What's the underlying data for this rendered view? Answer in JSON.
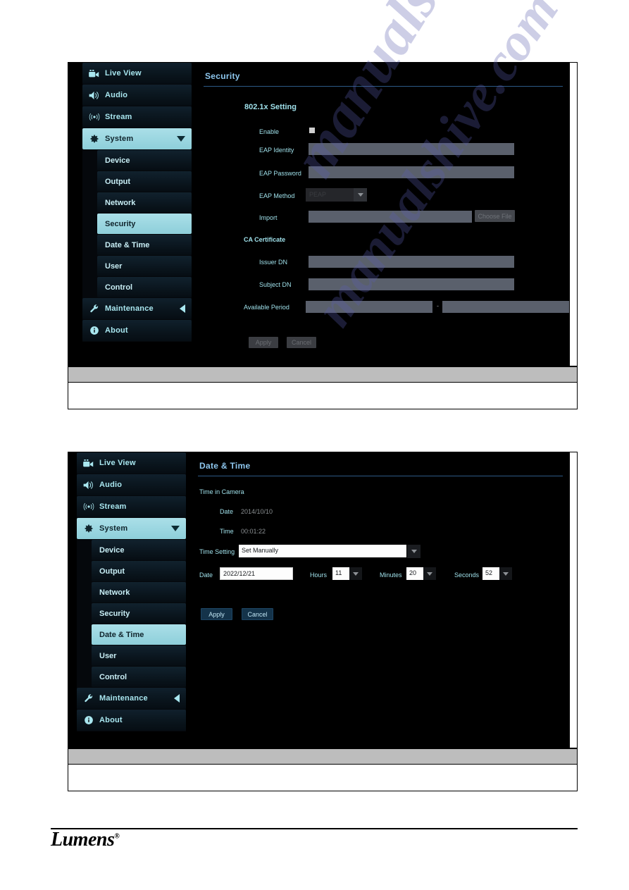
{
  "footer": {
    "brand": "Lumens",
    "registered_mark": "®"
  },
  "watermark": {
    "line1": "manualshive.com",
    "line2": "manualshive.com"
  },
  "figures": [
    {
      "id": "security-page",
      "pane_title": "Security",
      "sidebar": {
        "items": [
          {
            "label": "Live View",
            "icon": "video-camera-icon",
            "state": "normal",
            "arrow": "none"
          },
          {
            "label": "Audio",
            "icon": "speaker-icon",
            "state": "normal",
            "arrow": "none"
          },
          {
            "label": "Stream",
            "icon": "broadcast-icon",
            "state": "normal",
            "arrow": "none"
          },
          {
            "label": "System",
            "icon": "gear-icon",
            "state": "active",
            "arrow": "down"
          }
        ],
        "sub_items": [
          {
            "label": "Device",
            "state": "normal"
          },
          {
            "label": "Output",
            "state": "normal"
          },
          {
            "label": "Network",
            "state": "normal"
          },
          {
            "label": "Security",
            "state": "active"
          },
          {
            "label": "Date & Time",
            "state": "normal"
          },
          {
            "label": "User",
            "state": "normal"
          },
          {
            "label": "Control",
            "state": "normal"
          }
        ],
        "bottom_items": [
          {
            "label": "Maintenance",
            "icon": "wrench-icon",
            "state": "normal",
            "arrow": "left"
          },
          {
            "label": "About",
            "icon": "info-icon",
            "state": "normal",
            "arrow": "none"
          }
        ]
      },
      "form": {
        "section_802_title": "802.1x Setting",
        "enable_label": "Enable",
        "enable_checked": false,
        "eap_identity_label": "EAP Identity",
        "eap_identity_value": "",
        "eap_password_label": "EAP Password",
        "eap_password_value": "",
        "eap_method_label": "EAP Method",
        "eap_method_value": "PEAP",
        "import_label": "Import",
        "import_value": "",
        "choose_file_label": "Choose File",
        "ca_section_title": "CA Certificate",
        "issuer_dn_label": "Issuer DN",
        "issuer_dn_value": "",
        "subject_dn_label": "Subject DN",
        "subject_dn_value": "",
        "available_period_label": "Available Period",
        "available_period_from": "",
        "available_period_sep": "-",
        "available_period_to": "",
        "apply_label": "Apply",
        "cancel_label": "Cancel"
      },
      "caption": {
        "header": "",
        "body": ""
      }
    },
    {
      "id": "date-time-page",
      "pane_title": "Date & Time",
      "sidebar": {
        "items": [
          {
            "label": "Live View",
            "icon": "video-camera-icon",
            "state": "normal",
            "arrow": "none"
          },
          {
            "label": "Audio",
            "icon": "speaker-icon",
            "state": "normal",
            "arrow": "none"
          },
          {
            "label": "Stream",
            "icon": "broadcast-icon",
            "state": "normal",
            "arrow": "none"
          },
          {
            "label": "System",
            "icon": "gear-icon",
            "state": "active",
            "arrow": "down"
          }
        ],
        "sub_items": [
          {
            "label": "Device",
            "state": "normal"
          },
          {
            "label": "Output",
            "state": "normal"
          },
          {
            "label": "Network",
            "state": "normal"
          },
          {
            "label": "Security",
            "state": "normal"
          },
          {
            "label": "Date & Time",
            "state": "active"
          },
          {
            "label": "User",
            "state": "normal"
          },
          {
            "label": "Control",
            "state": "normal"
          }
        ],
        "bottom_items": [
          {
            "label": "Maintenance",
            "icon": "wrench-icon",
            "state": "normal",
            "arrow": "left"
          },
          {
            "label": "About",
            "icon": "info-icon",
            "state": "normal",
            "arrow": "none"
          }
        ]
      },
      "form": {
        "time_in_camera_label": "Time in Camera",
        "date_readonly_label": "Date",
        "date_readonly_value": "2014/10/10",
        "time_readonly_label": "Time",
        "time_readonly_value": "00:01:22",
        "time_setting_label": "Time Setting",
        "time_setting_value": "Set Manually",
        "date_label": "Date",
        "date_value": "2022/12/21",
        "hours_label": "Hours",
        "hours_value": "11",
        "minutes_label": "Minutes",
        "minutes_value": "20",
        "seconds_label": "Seconds",
        "seconds_value": "52",
        "apply_label": "Apply",
        "cancel_label": "Cancel"
      },
      "caption": {
        "header": "",
        "body": ""
      }
    }
  ]
}
